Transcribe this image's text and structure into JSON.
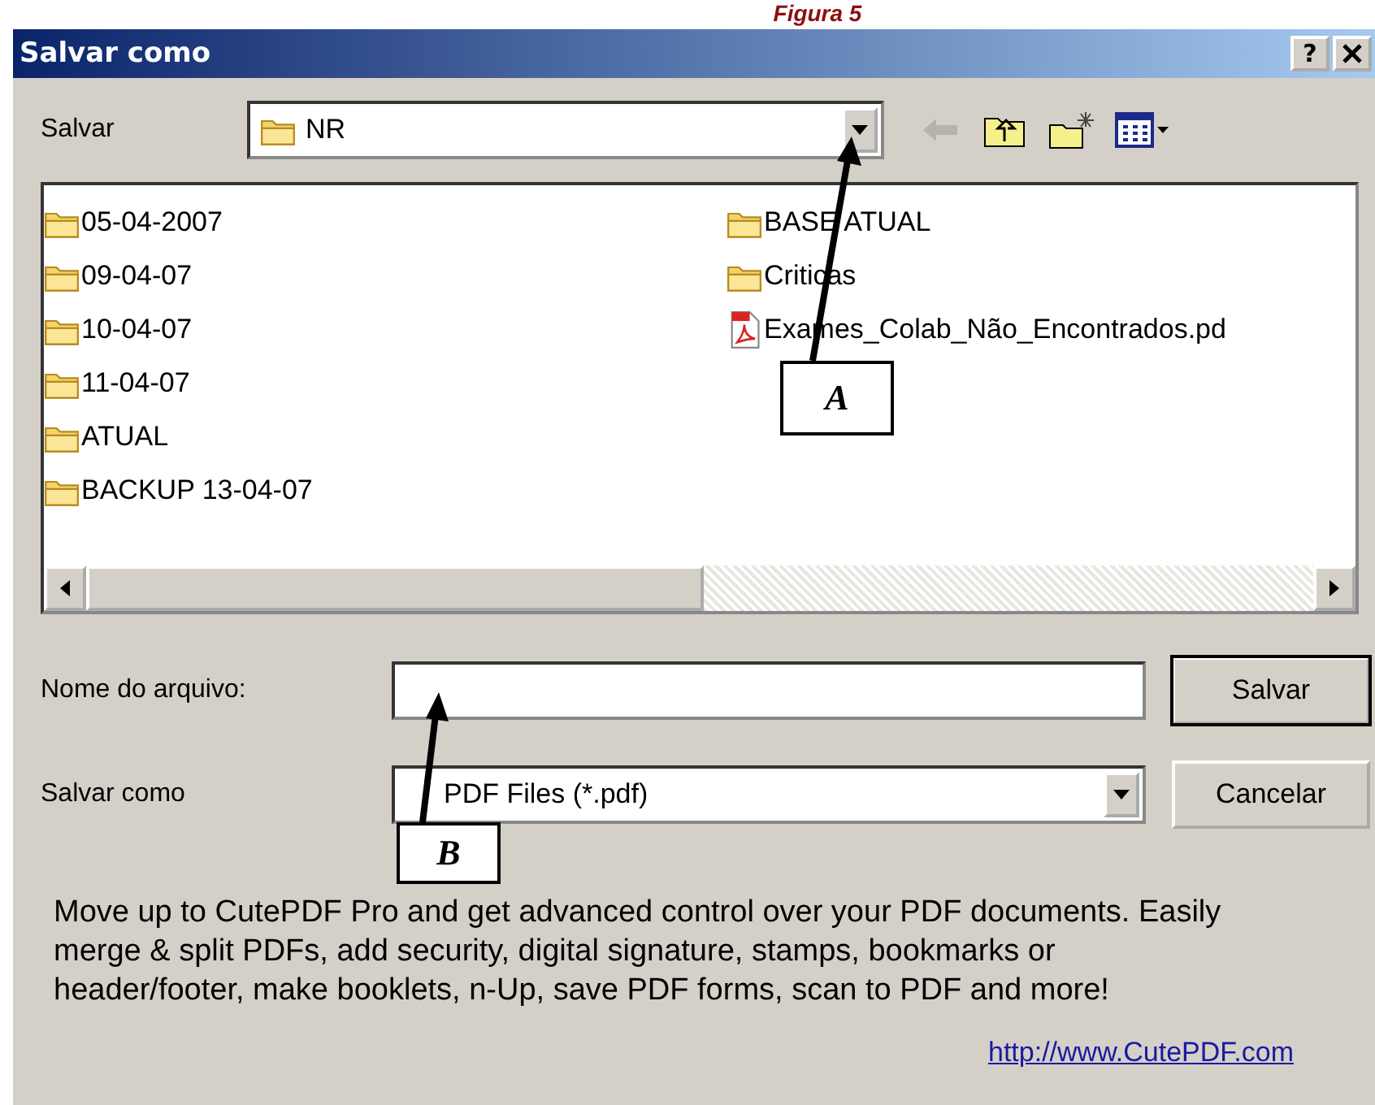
{
  "caption": "Figura 5",
  "window": {
    "title": "Salvar como",
    "help": "?"
  },
  "save_in": {
    "label": "Salvar",
    "value": "NR"
  },
  "toolbar": [
    {
      "kind": "back",
      "disabled": true
    },
    {
      "kind": "up",
      "disabled": false
    },
    {
      "kind": "new-folder",
      "disabled": false
    },
    {
      "kind": "views",
      "disabled": false
    }
  ],
  "files": [
    {
      "name": "05-04-2007",
      "kind": "folder"
    },
    {
      "name": "09-04-07",
      "kind": "folder"
    },
    {
      "name": "10-04-07",
      "kind": "folder"
    },
    {
      "name": "11-04-07",
      "kind": "folder"
    },
    {
      "name": "ATUAL",
      "kind": "folder"
    },
    {
      "name": "BACKUP 13-04-07",
      "kind": "folder"
    },
    {
      "name": "BASE ATUAL",
      "kind": "folder"
    },
    {
      "name": "Criticas",
      "kind": "folder"
    },
    {
      "name": "Exames_Colab_Não_Encontrados.pd",
      "kind": "pdf"
    }
  ],
  "file_name": {
    "label": "Nome do arquivo:"
  },
  "save_as_type": {
    "label": "Salvar como",
    "value": "PDF Files (*.pdf)"
  },
  "buttons": [
    {
      "label": "Salvar",
      "default": true
    },
    {
      "label": "Cancelar",
      "default": false
    }
  ],
  "promo": "Move up to CutePDF Pro and get advanced control over your PDF documents. Easily merge & split PDFs, add security, digital signature, stamps, bookmarks or header/footer, make booklets, n-Up, save PDF forms, scan to PDF and more!",
  "link": "http://www.CutePDF.com",
  "callouts": [
    {
      "label": "A"
    },
    {
      "label": "B"
    }
  ]
}
